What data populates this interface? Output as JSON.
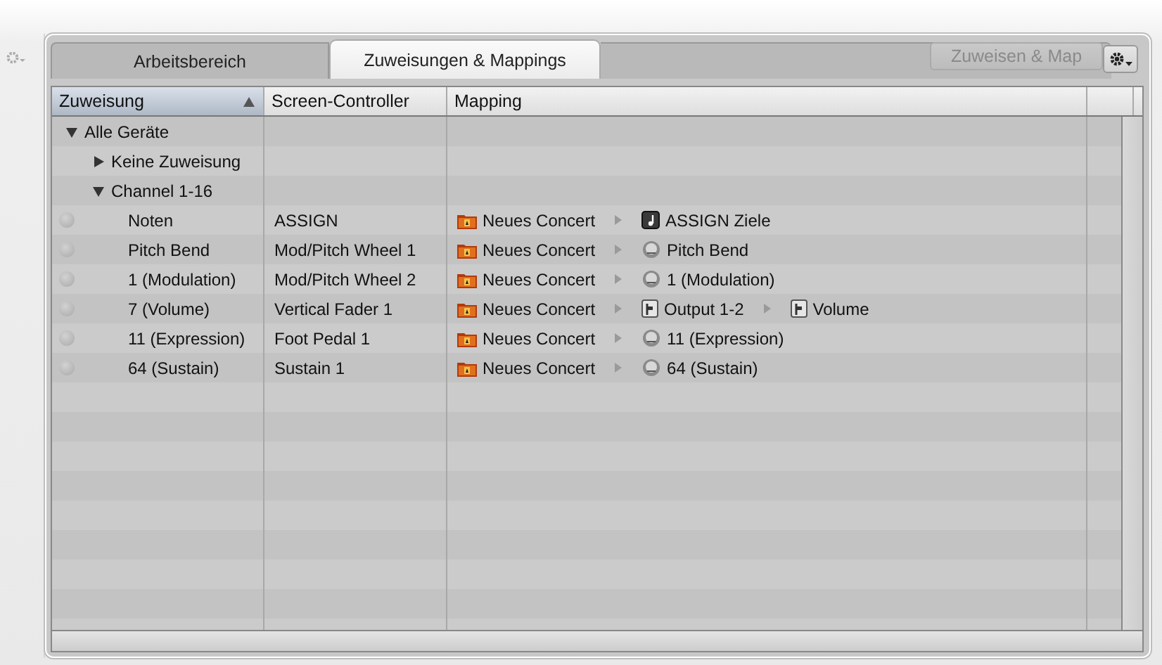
{
  "tabs": [
    {
      "label": "Arbeitsbereich",
      "selected": false
    },
    {
      "label": "Zuweisungen & Mappings",
      "selected": true
    }
  ],
  "assign_button": {
    "label": "Zuweisen & Map",
    "disabled": true
  },
  "table": {
    "columns": [
      {
        "label": "Zuweisung",
        "sorted": true
      },
      {
        "label": "Screen-Controller",
        "sorted": false
      },
      {
        "label": "Mapping",
        "sorted": false
      }
    ],
    "rows": [
      {
        "kind": "group",
        "label": "Alle Geräte",
        "expanded": true,
        "children": [
          {
            "kind": "group",
            "label": "Keine Zuweisung",
            "expanded": false
          },
          {
            "kind": "group",
            "label": "Channel 1-16",
            "expanded": true,
            "children": [
              {
                "kind": "assignment",
                "label": "Noten",
                "controller": "ASSIGN",
                "mapping": [
                  {
                    "kind": "concert",
                    "label": "Neues Concert"
                  },
                  {
                    "kind": "note",
                    "label": "ASSIGN Ziele"
                  }
                ]
              },
              {
                "kind": "assignment",
                "label": "Pitch Bend",
                "controller": "Mod/Pitch Wheel 1",
                "mapping": [
                  {
                    "kind": "concert",
                    "label": "Neues Concert"
                  },
                  {
                    "kind": "knob",
                    "label": "Pitch Bend"
                  }
                ]
              },
              {
                "kind": "assignment",
                "label": "1 (Modulation)",
                "controller": "Mod/Pitch Wheel 2",
                "mapping": [
                  {
                    "kind": "concert",
                    "label": "Neues Concert"
                  },
                  {
                    "kind": "knob",
                    "label": "1 (Modulation)"
                  }
                ]
              },
              {
                "kind": "assignment",
                "label": "7 (Volume)",
                "controller": "Vertical Fader 1",
                "mapping": [
                  {
                    "kind": "concert",
                    "label": "Neues Concert"
                  },
                  {
                    "kind": "fader",
                    "label": "Output 1-2"
                  },
                  {
                    "kind": "fader",
                    "label": "Volume"
                  }
                ]
              },
              {
                "kind": "assignment",
                "label": "11 (Expression)",
                "controller": "Foot Pedal 1",
                "mapping": [
                  {
                    "kind": "concert",
                    "label": "Neues Concert"
                  },
                  {
                    "kind": "knob",
                    "label": "11 (Expression)"
                  }
                ]
              },
              {
                "kind": "assignment",
                "label": "64 (Sustain)",
                "controller": "Sustain 1",
                "mapping": [
                  {
                    "kind": "concert",
                    "label": "Neues Concert"
                  },
                  {
                    "kind": "knob",
                    "label": "64 (Sustain)"
                  }
                ]
              }
            ]
          }
        ]
      }
    ]
  }
}
